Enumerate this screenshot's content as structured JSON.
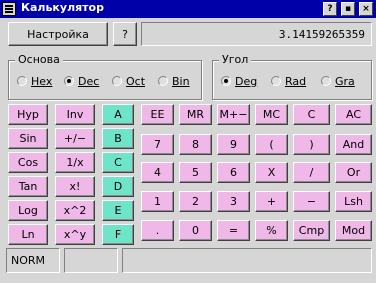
{
  "window": {
    "title": "Калькулятор",
    "controls": [
      "?",
      "▪",
      "×"
    ]
  },
  "top": {
    "settings_label": "Настройка",
    "help_label": "?",
    "display_value": "3.14159265359"
  },
  "base_group": {
    "title": "Основа",
    "options": [
      {
        "label": "Hex",
        "checked": false
      },
      {
        "label": "Dec",
        "checked": true
      },
      {
        "label": "Oct",
        "checked": false
      },
      {
        "label": "Bin",
        "checked": false
      }
    ]
  },
  "angle_group": {
    "title": "Угол",
    "options": [
      {
        "label": "Deg",
        "checked": true
      },
      {
        "label": "Rad",
        "checked": false
      },
      {
        "label": "Gra",
        "checked": false
      }
    ]
  },
  "function_keys": [
    [
      "Hyp",
      "Inv",
      "A"
    ],
    [
      "Sin",
      "+/−",
      "B"
    ],
    [
      "Cos",
      "1/x",
      "C"
    ],
    [
      "Tan",
      "x!",
      "D"
    ],
    [
      "Log",
      "x^2",
      "E"
    ],
    [
      "Ln",
      "x^y",
      "F"
    ]
  ],
  "main_keys": [
    [
      "EE",
      "MR",
      "M+−",
      "MC",
      "C",
      "AC"
    ],
    [
      "7",
      "8",
      "9",
      "(",
      ")",
      "And"
    ],
    [
      "4",
      "5",
      "6",
      "X",
      "/",
      "Or"
    ],
    [
      "1",
      "2",
      "3",
      "+",
      "−",
      "Lsh"
    ],
    [
      ".",
      "0",
      "=",
      "%",
      "Cmp",
      "Mod"
    ]
  ],
  "status": {
    "mode": "NORM",
    "memory": "",
    "info": ""
  },
  "colors": {
    "titlebar": "#0000a8",
    "key_pink": "#f0b8e8",
    "key_teal": "#6ee4c8",
    "face": "#d6d6d6"
  }
}
